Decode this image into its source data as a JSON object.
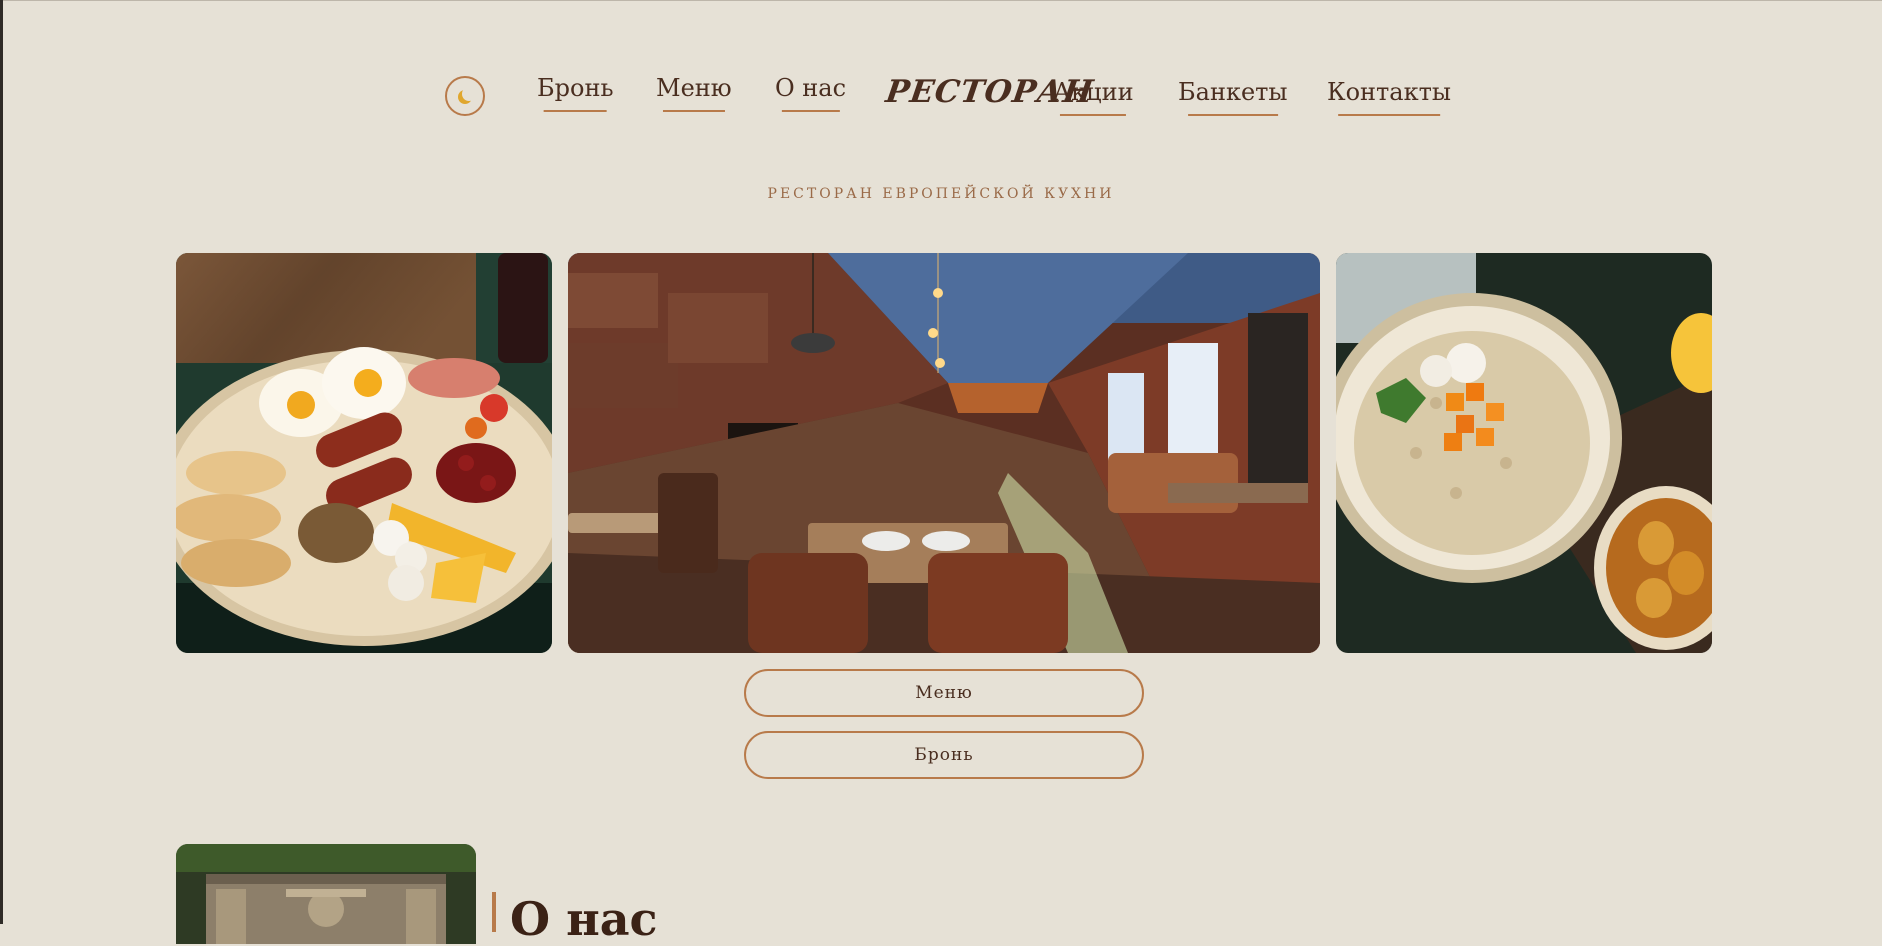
{
  "nav": {
    "theme_toggle_icon": "moon-icon",
    "items": [
      {
        "label": "Бронь"
      },
      {
        "label": "Меню"
      },
      {
        "label": "О нас"
      },
      {
        "label": "Акции"
      },
      {
        "label": "Банкеты"
      },
      {
        "label": "Контакты"
      }
    ],
    "logo": "РЕСТОРАН"
  },
  "hero": {
    "subtitle": "РЕСТОРАН ЕВРОПЕЙСКОЙ КУХНИ"
  },
  "buttons": {
    "menu": "Меню",
    "book": "Бронь"
  },
  "about": {
    "heading": "О нас"
  },
  "colors": {
    "background": "#e6e1d6",
    "accent": "#b87a4a",
    "text": "#4a2e20",
    "subtitle": "#9a6a48"
  }
}
